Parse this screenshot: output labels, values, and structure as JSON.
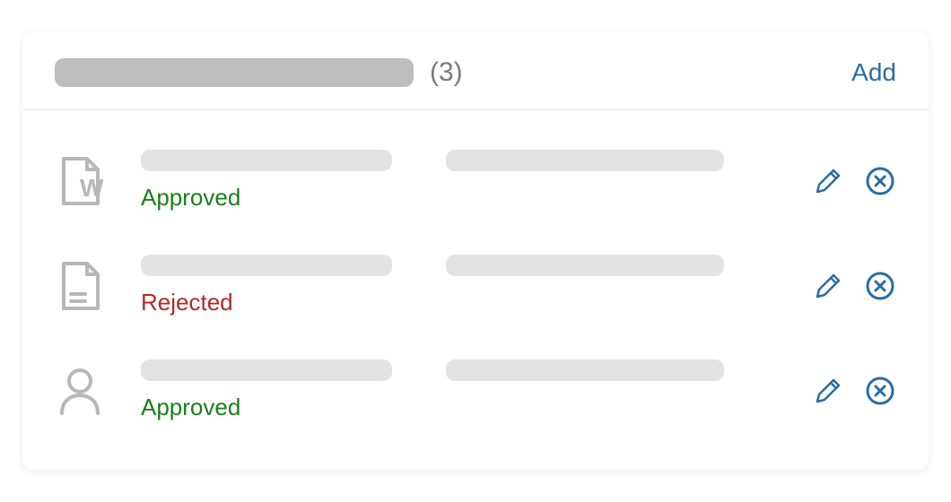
{
  "header": {
    "count_label": "(3)",
    "add_label": "Add"
  },
  "rows": [
    {
      "icon": "file-word",
      "status": "Approved",
      "status_class": "approved"
    },
    {
      "icon": "file-text",
      "status": "Rejected",
      "status_class": "rejected"
    },
    {
      "icon": "person",
      "status": "Approved",
      "status_class": "approved"
    }
  ],
  "colors": {
    "icon_stroke": "#b7b7b7",
    "action_stroke": "#2b6ca3"
  }
}
